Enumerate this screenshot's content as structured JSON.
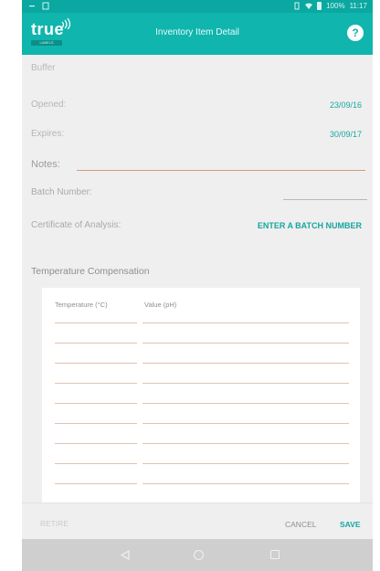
{
  "status_bar": {
    "battery_percent": "100%",
    "time": "11:17"
  },
  "app_bar": {
    "logo_text": "true",
    "logo_tag": "LABELS",
    "title": "Inventory Item Detail",
    "help_label": "?"
  },
  "item": {
    "name": "Buffer",
    "opened_label": "Opened:",
    "opened_value": "23/09/16",
    "expires_label": "Expires:",
    "expires_value": "30/09/17",
    "notes_label": "Notes:",
    "batch_label": "Batch Number:",
    "certificate_label": "Certificate of Analysis:",
    "certificate_action": "ENTER A BATCH NUMBER"
  },
  "temperature": {
    "title": "Temperature Compensation",
    "col_temperature": "Temperature (°C)",
    "col_value": "Value (pH)"
  },
  "footer": {
    "retire": "RETIRE",
    "cancel": "CANCEL",
    "save": "SAVE"
  },
  "icons": {
    "nav_back": "back-triangle-icon",
    "nav_home": "home-circle-icon",
    "nav_recent": "recent-apps-square-icon"
  },
  "colors": {
    "accent": "#10b5ad",
    "status_bar": "#0aa8a0",
    "action_text": "#17a69f"
  }
}
